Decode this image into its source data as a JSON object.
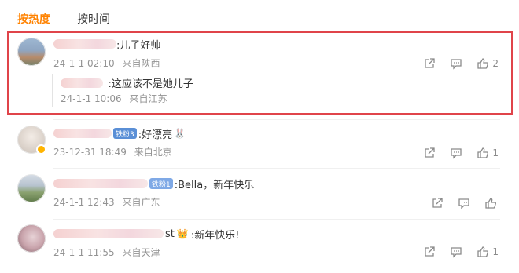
{
  "tabs": [
    {
      "label": "按热度",
      "active": true
    },
    {
      "label": "按时间",
      "active": false
    }
  ],
  "comments": [
    {
      "text": ":儿子好帅",
      "time": "24-1-1 02:10",
      "location": "来自陕西",
      "like_count": "2",
      "reply": {
        "text": "_:这应该不是她儿子",
        "time": "24-1-1 10:06",
        "location": "来自江苏"
      }
    },
    {
      "text": ":好漂亮",
      "badge": "铁粉3",
      "time": "23-12-31 18:49",
      "location": "来自北京",
      "like_count": "1"
    },
    {
      "text": ":Bella，新年快乐",
      "badge": "铁粉1",
      "time": "24-1-1 12:43",
      "location": "来自广东",
      "like_count": ""
    },
    {
      "name_fragment": "st",
      "text": ":新年快乐!",
      "time": "24-1-1 11:55",
      "location": "来自天津",
      "like_count": "1"
    }
  ],
  "colors": {
    "accent": "#ff8200",
    "highlight": "#e0444a",
    "meta": "#939393"
  }
}
